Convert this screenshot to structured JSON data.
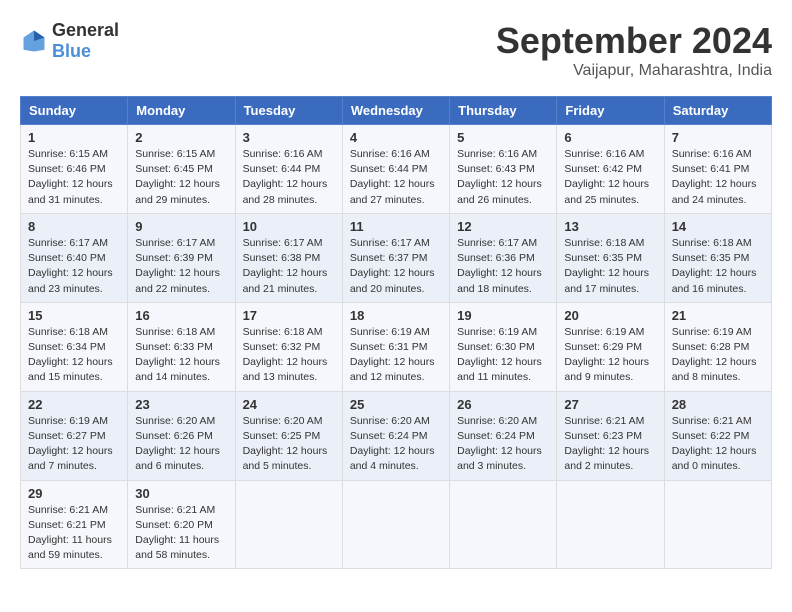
{
  "header": {
    "logo": {
      "general": "General",
      "blue": "Blue"
    },
    "title": "September 2024",
    "location": "Vaijapur, Maharashtra, India"
  },
  "weekdays": [
    "Sunday",
    "Monday",
    "Tuesday",
    "Wednesday",
    "Thursday",
    "Friday",
    "Saturday"
  ],
  "weeks": [
    [
      {
        "day": "1",
        "sunrise": "6:15 AM",
        "sunset": "6:46 PM",
        "daylight": "12 hours and 31 minutes."
      },
      {
        "day": "2",
        "sunrise": "6:15 AM",
        "sunset": "6:45 PM",
        "daylight": "12 hours and 29 minutes."
      },
      {
        "day": "3",
        "sunrise": "6:16 AM",
        "sunset": "6:44 PM",
        "daylight": "12 hours and 28 minutes."
      },
      {
        "day": "4",
        "sunrise": "6:16 AM",
        "sunset": "6:44 PM",
        "daylight": "12 hours and 27 minutes."
      },
      {
        "day": "5",
        "sunrise": "6:16 AM",
        "sunset": "6:43 PM",
        "daylight": "12 hours and 26 minutes."
      },
      {
        "day": "6",
        "sunrise": "6:16 AM",
        "sunset": "6:42 PM",
        "daylight": "12 hours and 25 minutes."
      },
      {
        "day": "7",
        "sunrise": "6:16 AM",
        "sunset": "6:41 PM",
        "daylight": "12 hours and 24 minutes."
      }
    ],
    [
      {
        "day": "8",
        "sunrise": "6:17 AM",
        "sunset": "6:40 PM",
        "daylight": "12 hours and 23 minutes."
      },
      {
        "day": "9",
        "sunrise": "6:17 AM",
        "sunset": "6:39 PM",
        "daylight": "12 hours and 22 minutes."
      },
      {
        "day": "10",
        "sunrise": "6:17 AM",
        "sunset": "6:38 PM",
        "daylight": "12 hours and 21 minutes."
      },
      {
        "day": "11",
        "sunrise": "6:17 AM",
        "sunset": "6:37 PM",
        "daylight": "12 hours and 20 minutes."
      },
      {
        "day": "12",
        "sunrise": "6:17 AM",
        "sunset": "6:36 PM",
        "daylight": "12 hours and 18 minutes."
      },
      {
        "day": "13",
        "sunrise": "6:18 AM",
        "sunset": "6:35 PM",
        "daylight": "12 hours and 17 minutes."
      },
      {
        "day": "14",
        "sunrise": "6:18 AM",
        "sunset": "6:35 PM",
        "daylight": "12 hours and 16 minutes."
      }
    ],
    [
      {
        "day": "15",
        "sunrise": "6:18 AM",
        "sunset": "6:34 PM",
        "daylight": "12 hours and 15 minutes."
      },
      {
        "day": "16",
        "sunrise": "6:18 AM",
        "sunset": "6:33 PM",
        "daylight": "12 hours and 14 minutes."
      },
      {
        "day": "17",
        "sunrise": "6:18 AM",
        "sunset": "6:32 PM",
        "daylight": "12 hours and 13 minutes."
      },
      {
        "day": "18",
        "sunrise": "6:19 AM",
        "sunset": "6:31 PM",
        "daylight": "12 hours and 12 minutes."
      },
      {
        "day": "19",
        "sunrise": "6:19 AM",
        "sunset": "6:30 PM",
        "daylight": "12 hours and 11 minutes."
      },
      {
        "day": "20",
        "sunrise": "6:19 AM",
        "sunset": "6:29 PM",
        "daylight": "12 hours and 9 minutes."
      },
      {
        "day": "21",
        "sunrise": "6:19 AM",
        "sunset": "6:28 PM",
        "daylight": "12 hours and 8 minutes."
      }
    ],
    [
      {
        "day": "22",
        "sunrise": "6:19 AM",
        "sunset": "6:27 PM",
        "daylight": "12 hours and 7 minutes."
      },
      {
        "day": "23",
        "sunrise": "6:20 AM",
        "sunset": "6:26 PM",
        "daylight": "12 hours and 6 minutes."
      },
      {
        "day": "24",
        "sunrise": "6:20 AM",
        "sunset": "6:25 PM",
        "daylight": "12 hours and 5 minutes."
      },
      {
        "day": "25",
        "sunrise": "6:20 AM",
        "sunset": "6:24 PM",
        "daylight": "12 hours and 4 minutes."
      },
      {
        "day": "26",
        "sunrise": "6:20 AM",
        "sunset": "6:24 PM",
        "daylight": "12 hours and 3 minutes."
      },
      {
        "day": "27",
        "sunrise": "6:21 AM",
        "sunset": "6:23 PM",
        "daylight": "12 hours and 2 minutes."
      },
      {
        "day": "28",
        "sunrise": "6:21 AM",
        "sunset": "6:22 PM",
        "daylight": "12 hours and 0 minutes."
      }
    ],
    [
      {
        "day": "29",
        "sunrise": "6:21 AM",
        "sunset": "6:21 PM",
        "daylight": "11 hours and 59 minutes."
      },
      {
        "day": "30",
        "sunrise": "6:21 AM",
        "sunset": "6:20 PM",
        "daylight": "11 hours and 58 minutes."
      },
      null,
      null,
      null,
      null,
      null
    ]
  ]
}
